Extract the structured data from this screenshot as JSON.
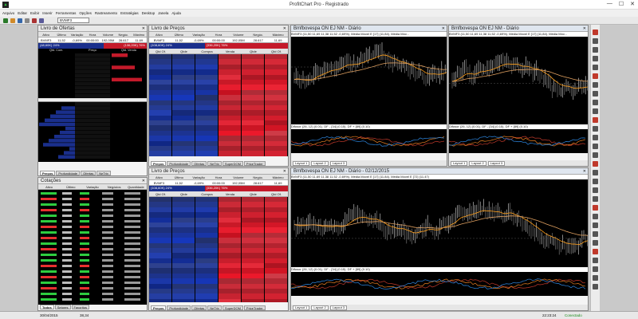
{
  "window": {
    "title": "ProfitChart Pro - Registrado",
    "min": "—",
    "max": "☐",
    "close": "✕"
  },
  "menu": [
    "Arquivo",
    "Editar",
    "Exibir",
    "Inserir",
    "Ferramentas",
    "Opções",
    "Rastreamento",
    "Estratégias",
    "Desktop",
    "Janela",
    "Ajuda"
  ],
  "toolbar": {
    "ticker": "BVMF3"
  },
  "offers_panel": {
    "title": "Livro de Ofertas",
    "cols": [
      "Ativo",
      "Último",
      "Variação",
      "Hora",
      "Volume",
      "Negóc.",
      "Máximo"
    ],
    "row": [
      "BVMF3",
      "11,52",
      "-0,69%",
      "00:00:00",
      "192,05M",
      "28.617",
      "11,69"
    ],
    "bar_left": "(48,60K) 24%",
    "bar_right": "(136,20K) 76%",
    "subcols": [
      "Qtd. Com.",
      "Preço",
      "Qtd. Venda"
    ],
    "tabs": [
      "Preços",
      "Profundidade",
      "Ofertas",
      "NeTrix"
    ]
  },
  "quotes_panel": {
    "title": "Cotações",
    "cols": [
      "Ativo",
      "Último",
      "Variação",
      "Negócios",
      "Quantidade"
    ],
    "tabs": [
      "Todos",
      "Setores",
      "Favoritos"
    ]
  },
  "book_top": {
    "title": "Livro de Preços",
    "cols": [
      "Ativo",
      "Último",
      "Variação",
      "Hora",
      "Volume",
      "Negóc.",
      "Máximo"
    ],
    "row": [
      "BVMF3",
      "11,52",
      "-0,69%",
      "00:00:00",
      "192,05M",
      "28.617",
      "11,69"
    ],
    "bar_left": "(108,60K) 24%",
    "bar_right": "(336,20K) 76%",
    "subcols": [
      "Qtd Of.",
      "Qtde",
      "Compra",
      "Venda",
      "Qtde",
      "Qtd Of."
    ],
    "tabs": [
      "Preços",
      "Profundidade",
      "Ofertas",
      "NeTrix",
      "SuperDOM",
      "PriceTrader"
    ]
  },
  "book_bottom": {
    "title": "Livro de Preços",
    "cols": [
      "Ativo",
      "Último",
      "Variação",
      "Hora",
      "Volume",
      "Negóc.",
      "Máximo"
    ],
    "row": [
      "BVMF3",
      "11,52",
      "-0,69%",
      "00:00:00",
      "192,05M",
      "28.617",
      "11,69"
    ],
    "bar_left": "(108,60K) 24%",
    "bar_right": "(336,20K) 76%",
    "subcols": [
      "Qtd Of.",
      "Qtde",
      "Compra",
      "Venda",
      "Qtde",
      "Qtd Of."
    ],
    "tabs": [
      "Preços",
      "Profundidade",
      "Ofertas",
      "NeTrix",
      "SuperDOM",
      "PriceTrader"
    ]
  },
  "chart1": {
    "title": "Bmfbovespa ON EJ NM - Diário",
    "header": "BVMF3 (11,50  11,69  11,38  11,52  -0,69%). Média Móvel E [17] (11,84). Média Móv...",
    "osc": "Difusor (26, 12) (0.01). DF - [34] (0.15). DF + [89] (0.10)",
    "layouts": [
      "Layout 1",
      "Layout 2",
      "Layout 3"
    ]
  },
  "chart2": {
    "title": "Bmfbovespa ON EJ NM - Diário",
    "header": "BVMF3 (11,50  11,69  11,38  11,52  -0,69%). Média Móvel E [17] (11,84). Média Móv...",
    "osc": "Difusor (26, 12) (0.01). DF - [34] (0.15). DF + [89] (0.10)",
    "layouts": [
      "Layout 1",
      "Layout 2",
      "Layout 3"
    ]
  },
  "chart3": {
    "title": "Bmfbovespa ON EJ NM - Diário - 02/12/2015",
    "header": "BVMF3 (11,50  11,69  11,38  11,52  -0,69%). Média Móvel E [17] (11,84). Média Móvel E [72] (11,47)",
    "osc": "Difusor (26, 12) (0.01). DF - [34] (0.15). DF + [89] (0.10)",
    "layouts": [
      "Layout 1",
      "Layout 2",
      "Layout 3"
    ]
  },
  "status": {
    "date": "30/04/2015",
    "price": "38,34",
    "time": "22:23:24",
    "conn": "Conectado"
  },
  "colors": {
    "buy": "#1a2f8c",
    "sell": "#c41a2a",
    "bg": "#000"
  }
}
